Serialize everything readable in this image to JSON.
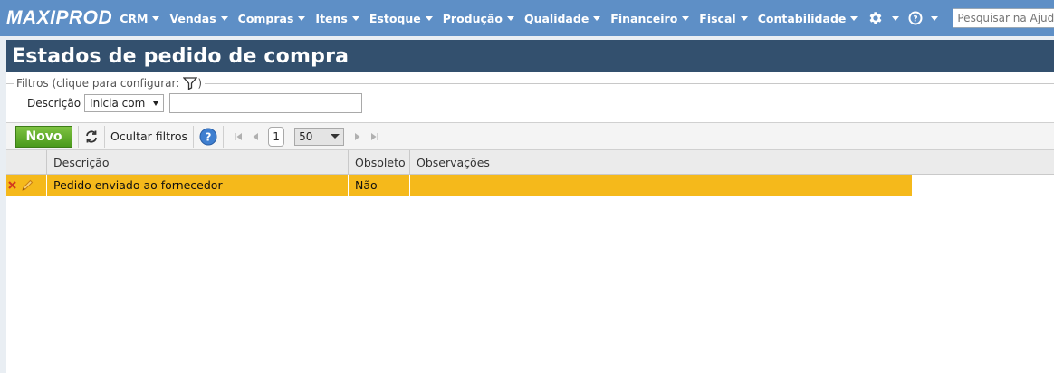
{
  "app": {
    "logo": "MAXIPROD"
  },
  "nav": {
    "items": [
      {
        "label": "CRM"
      },
      {
        "label": "Vendas"
      },
      {
        "label": "Compras"
      },
      {
        "label": "Itens"
      },
      {
        "label": "Estoque"
      },
      {
        "label": "Produção"
      },
      {
        "label": "Qualidade"
      },
      {
        "label": "Financeiro"
      },
      {
        "label": "Fiscal"
      },
      {
        "label": "Contabilidade"
      }
    ],
    "settings_icon": "gear-icon",
    "help_icon": "question-circle-icon",
    "search_placeholder": "Pesquisar na Ajuda..."
  },
  "page": {
    "title": "Estados de pedido de compra"
  },
  "filters": {
    "legend": "Filtros (clique para configurar:",
    "legend_close": ")",
    "legend_icon": "funnel-icon",
    "field_label": "Descrição",
    "mode_selected": "Inicia com",
    "value": ""
  },
  "toolbar": {
    "new_label": "Novo",
    "refresh_icon": "refresh-icon",
    "hide_filters_label": "Ocultar filtros",
    "help_icon": "help-icon",
    "current_page": "1",
    "per_page": "50"
  },
  "grid": {
    "columns": [
      "Descrição",
      "Obsoleto",
      "Observações"
    ],
    "rows": [
      {
        "descricao": "Pedido enviado ao fornecedor",
        "obsoleto": "Não",
        "observacoes": ""
      }
    ]
  },
  "colors": {
    "topbar": "#5e8fc6",
    "title_bar": "#33506e",
    "row_highlight": "#f5b91b",
    "new_button": "#5aa827"
  }
}
